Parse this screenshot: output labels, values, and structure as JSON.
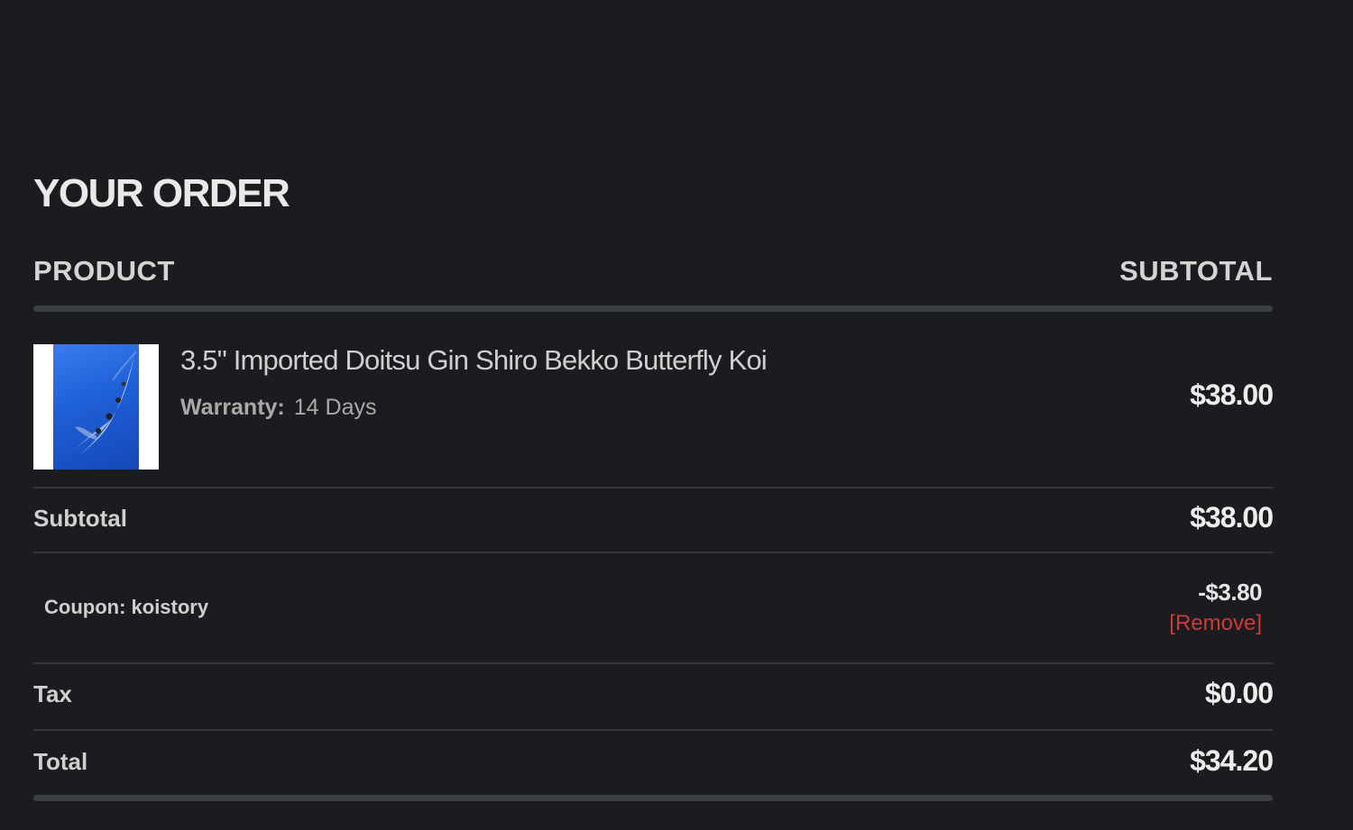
{
  "order": {
    "title": "YOUR ORDER",
    "columns": {
      "product": "PRODUCT",
      "subtotal": "SUBTOTAL"
    },
    "item": {
      "name": "3.5\" Imported Doitsu Gin Shiro Bekko Butterfly Koi",
      "warranty_label": "Warranty:",
      "warranty_value": "14 Days",
      "price": "$38.00",
      "thumbnail_icon": "koi-fish-photo"
    },
    "subtotal": {
      "label": "Subtotal",
      "value": "$38.00"
    },
    "coupon": {
      "label": "Coupon: koistory",
      "value": "-$3.80",
      "remove_label": "[Remove]"
    },
    "tax": {
      "label": "Tax",
      "value": "$0.00"
    },
    "total": {
      "label": "Total",
      "value": "$34.20"
    }
  },
  "colors": {
    "background": "#1b1c1f",
    "rule": "#3c3f45",
    "remove_link": "#d23838",
    "thumbnail_blue": "#2a68e0"
  }
}
